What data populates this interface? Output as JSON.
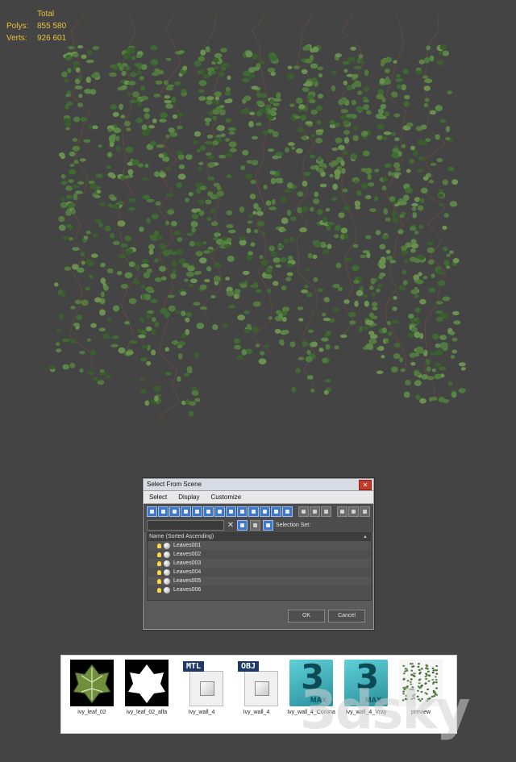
{
  "viewport_stats": {
    "total_label": "Total",
    "polys_label": "Polys:",
    "polys_value": "855 580",
    "verts_label": "Verts:",
    "verts_value": "926 601"
  },
  "dialog": {
    "title": "Select From Scene",
    "close_glyph": "✕",
    "menu": [
      "Select",
      "Display",
      "Customize"
    ],
    "selection_set_label": "Selection Set:",
    "clear_glyph": "✕",
    "column_header": "Name (Sorted Ascending)",
    "items": [
      "Leaves001",
      "Leaves002",
      "Leaves003",
      "Leaves004",
      "Leaves005",
      "Leaves006"
    ],
    "ok_label": "OK",
    "cancel_label": "Cancel"
  },
  "files": [
    {
      "name": "ivy_leaf_02",
      "kind": "texture"
    },
    {
      "name": "ivy_leaf_02_alfa",
      "kind": "alpha"
    },
    {
      "name": "Ivy_wall_4",
      "kind": "document",
      "tag": "MTL"
    },
    {
      "name": "Ivy_wall_4",
      "kind": "document",
      "tag": "OBJ"
    },
    {
      "name": "Ivy_wall_4_Corona",
      "kind": "max",
      "glyph": "3",
      "badge": "MAX"
    },
    {
      "name": "Ivy_wall_4_Vray",
      "kind": "max",
      "glyph": "3",
      "badge": "MAX"
    },
    {
      "name": "preview",
      "kind": "image"
    }
  ],
  "watermark": "3dsky",
  "colors": {
    "background": "#444444",
    "stats_text": "#e8c23a",
    "ivy_leaf": "#4e7a3e",
    "toolbar_button": "#3f77c9",
    "close_button": "#c63a2a"
  }
}
